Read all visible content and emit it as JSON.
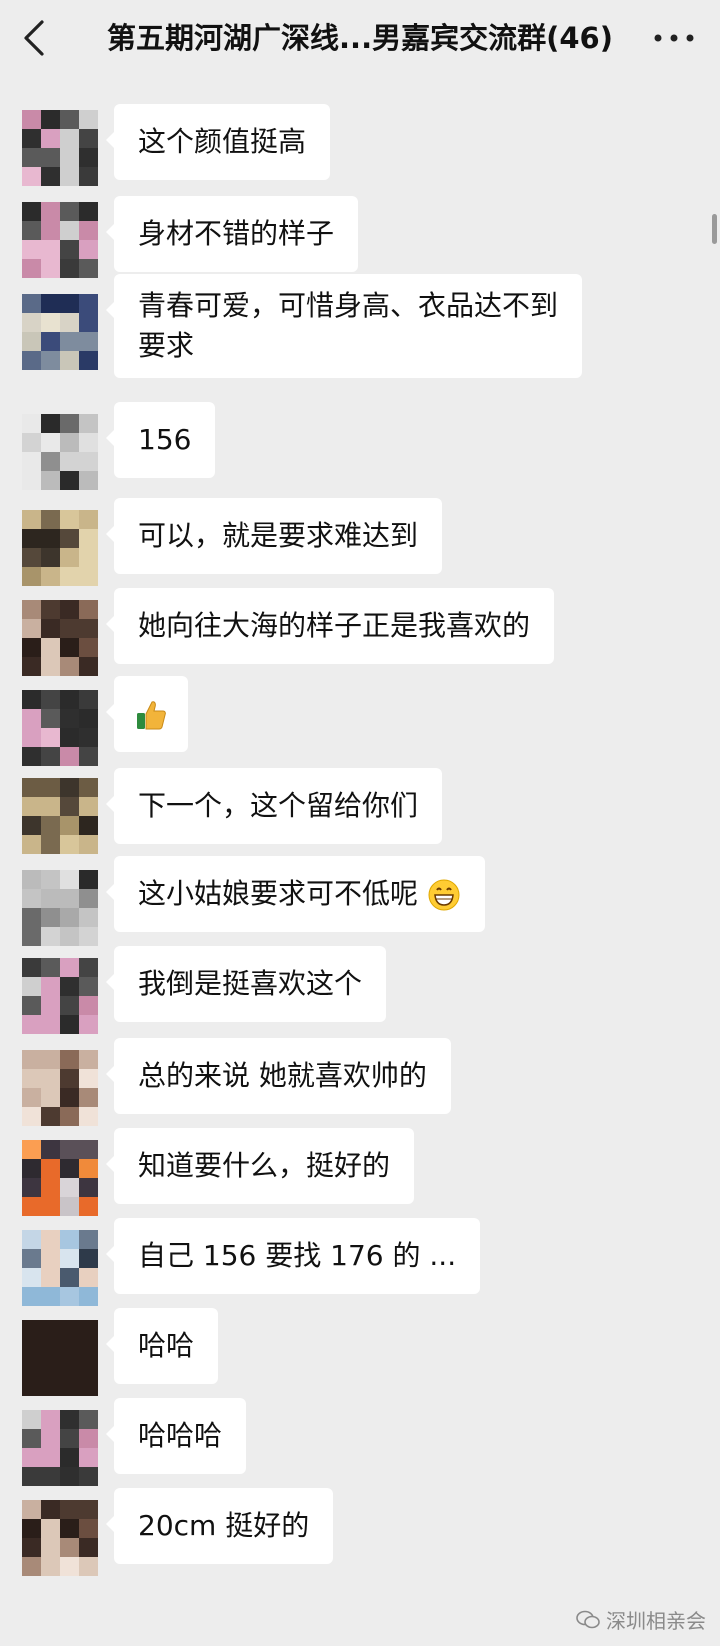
{
  "header": {
    "title": "第五期河湖广深线...男嘉宾交流群(46)",
    "back_icon": "chevron-left-icon",
    "more_icon": "more-horizontal-icon"
  },
  "messages": [
    {
      "text": "这个颜值挺高"
    },
    {
      "text": "身材不错的样子"
    },
    {
      "text": "青春可爱，可惜身高、衣品达不到",
      "text2": "要求"
    },
    {
      "text": "156"
    },
    {
      "text": "可以，就是要求难达到"
    },
    {
      "text": "她向往大海的样子正是我喜欢的"
    },
    {
      "text": "",
      "emoji": "thumbs-up-icon"
    },
    {
      "text": "下一个，这个留给你们"
    },
    {
      "text": "这小姑娘要求可不低呢",
      "emoji": "grinning-face-icon"
    },
    {
      "text": "我倒是挺喜欢这个"
    },
    {
      "text": "总的来说 她就喜欢帅的"
    },
    {
      "text": "知道要什么，挺好的"
    },
    {
      "text": "自己 156 要找 176 的 ..."
    },
    {
      "text": "哈哈"
    },
    {
      "text": "哈哈哈"
    },
    {
      "text": "20cm 挺好的"
    }
  ],
  "watermark": {
    "text": "深圳相亲会",
    "icon": "wechat-official-account-icon"
  },
  "colors": {
    "background": "#ededed",
    "bubble": "#ffffff",
    "text": "#111111"
  }
}
